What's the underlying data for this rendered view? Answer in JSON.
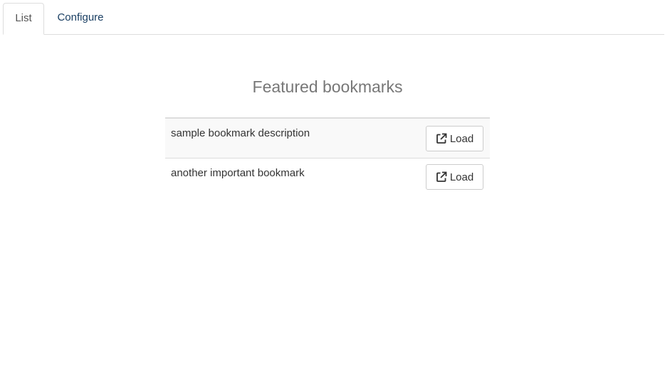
{
  "tabs": {
    "list_label": "List",
    "configure_label": "Configure"
  },
  "main": {
    "title": "Featured bookmarks",
    "bookmarks": [
      {
        "description": "sample bookmark description",
        "button_label": "Load",
        "icon": "external-link-icon"
      },
      {
        "description": "another important bookmark",
        "button_label": "Load",
        "icon": "external-link-icon"
      }
    ]
  }
}
